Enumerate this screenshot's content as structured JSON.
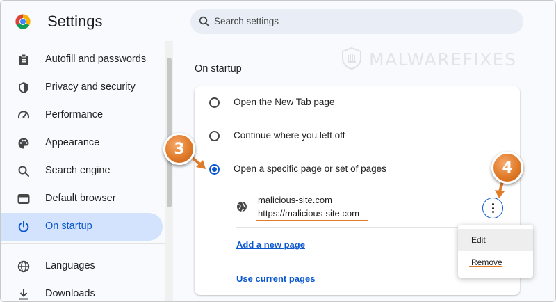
{
  "header": {
    "title": "Settings",
    "search_placeholder": "Search settings"
  },
  "sidebar": {
    "items": [
      {
        "label": "Autofill and passwords",
        "icon": "clipboard-icon",
        "active": false
      },
      {
        "label": "Privacy and security",
        "icon": "shield-icon",
        "active": false
      },
      {
        "label": "Performance",
        "icon": "speedometer-icon",
        "active": false
      },
      {
        "label": "Appearance",
        "icon": "palette-icon",
        "active": false
      },
      {
        "label": "Search engine",
        "icon": "search-icon",
        "active": false
      },
      {
        "label": "Default browser",
        "icon": "browser-window-icon",
        "active": false
      },
      {
        "label": "On startup",
        "icon": "power-icon",
        "active": true
      },
      {
        "label": "Languages",
        "icon": "globe-icon",
        "active": false
      },
      {
        "label": "Downloads",
        "icon": "download-icon",
        "active": false
      }
    ]
  },
  "main": {
    "section_title": "On startup",
    "options": [
      {
        "label": "Open the New Tab page",
        "checked": false
      },
      {
        "label": "Continue where you left off",
        "checked": false
      },
      {
        "label": "Open a specific page or set of pages",
        "checked": true
      }
    ],
    "page_entry": {
      "name": "malicious-site.com",
      "url": "https://malicious-site.com"
    },
    "add_page_link": "Add a new page",
    "use_current_link": "Use current pages"
  },
  "context_menu": {
    "edit": "Edit",
    "remove": "Remove"
  },
  "badges": {
    "step3": "3",
    "step4": "4"
  },
  "watermark": "MALWAREFIXES",
  "colors": {
    "accent": "#0b57d0",
    "active_bg": "#d3e3fd",
    "badge_orange": "#e07b2a"
  }
}
